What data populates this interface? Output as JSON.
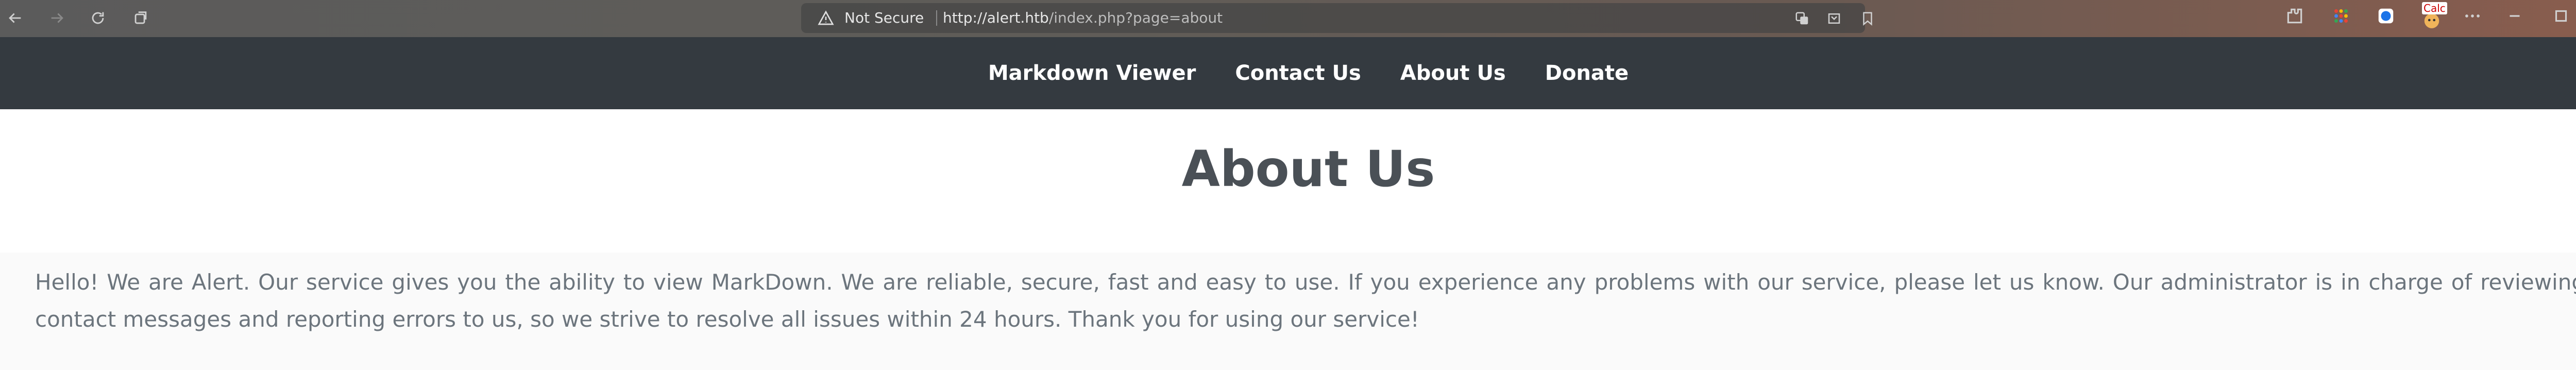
{
  "browser": {
    "security_label": "Not Secure",
    "url_host": "http://alert.htb",
    "url_path": "/index.php?page=about",
    "extension_badge": "Calc",
    "icons": [
      "back-icon",
      "forward-icon",
      "reload-icon",
      "tab-list-icon",
      "warning-icon",
      "translate-icon",
      "download-icon",
      "bookmark-icon",
      "extensions-icon",
      "apps-icon",
      "profile-icon",
      "more-icon",
      "minimize-icon",
      "maximize-icon",
      "close-icon"
    ]
  },
  "nav": {
    "items": [
      {
        "label": "Markdown Viewer"
      },
      {
        "label": "Contact Us"
      },
      {
        "label": "About Us"
      },
      {
        "label": "Donate"
      }
    ]
  },
  "page": {
    "title": "About Us",
    "body": "Hello! We are Alert. Our service gives you the ability to view MarkDown. We are reliable, secure, fast and easy to use. If you experience any problems with our service, please let us know. Our administrator is in charge of reviewing contact messages and reporting errors to us, so we strive to resolve all issues within 24 hours. Thank you for using our service!"
  },
  "colors": {
    "nav_bg": "#343a40",
    "title": "#4a5056",
    "body_text": "#6c757d"
  }
}
